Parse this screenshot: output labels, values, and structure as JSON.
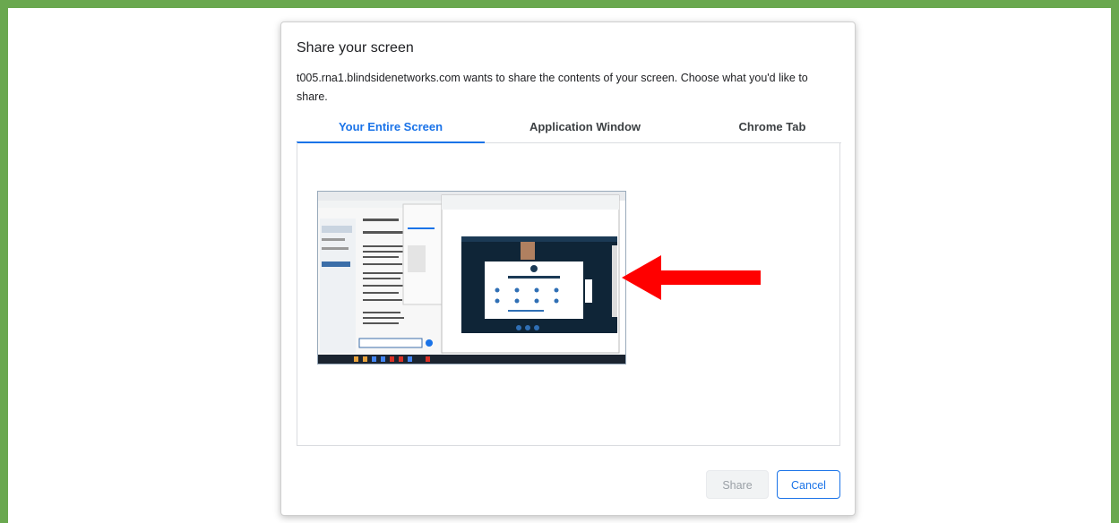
{
  "dialog": {
    "title": "Share your screen",
    "description": "t005.rna1.blindsidenetworks.com wants to share the contents of your screen. Choose what you'd like to share.",
    "tabs": [
      {
        "label": "Your Entire Screen",
        "active": true
      },
      {
        "label": "Application Window",
        "active": false
      },
      {
        "label": "Chrome Tab",
        "active": false
      }
    ],
    "share_label": "Share",
    "cancel_label": "Cancel"
  },
  "colors": {
    "frame_border": "#6aa84f",
    "accent": "#1a73e8",
    "annotation_arrow": "#ff0000"
  },
  "icons": [
    "red-arrow-icon"
  ]
}
